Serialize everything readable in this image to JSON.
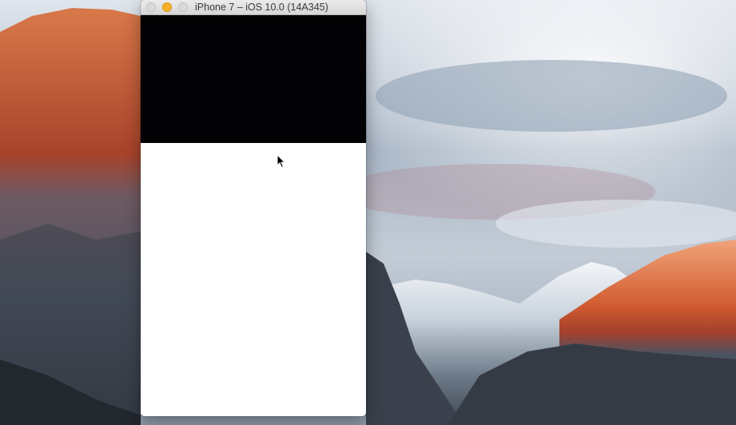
{
  "desktop": {
    "wallpaper_icon": "mountain-landscape-icon"
  },
  "simulator": {
    "title": "iPhone 7 – iOS 10.0 (14A345)",
    "buttons": {
      "close_icon": "close-icon",
      "minimize_icon": "minimize-icon",
      "zoom_icon": "zoom-icon"
    },
    "colors": {
      "screen_top": "#020204",
      "screen_body": "#ffffff",
      "minimize_button": "#f5b027"
    }
  },
  "cursor": {
    "icon": "arrow-pointer-icon"
  }
}
